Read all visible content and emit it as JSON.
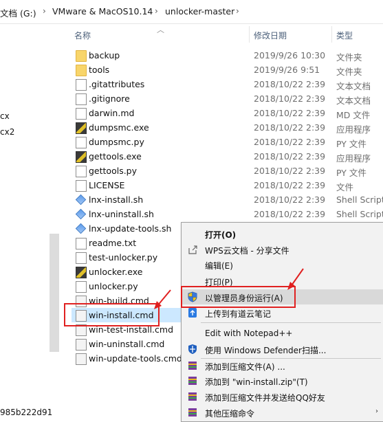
{
  "address": {
    "drive": "文档 (G:)",
    "folder1": "VMware & MacOS10.14",
    "folder2": "unlocker-master"
  },
  "nav": {
    "item_cx": "cx",
    "item_cx2": "cx2",
    "hash": "985b222d91"
  },
  "headers": {
    "name": "名称",
    "date": "修改日期",
    "type": "类型"
  },
  "files": [
    {
      "name": "backup",
      "date": "2019/9/26 10:30",
      "type": "文件夹",
      "icon": "folder"
    },
    {
      "name": "tools",
      "date": "2019/9/26 9:51",
      "type": "文件夹",
      "icon": "folder"
    },
    {
      "name": ".gitattributes",
      "date": "2018/10/22 2:39",
      "type": "文本文档",
      "icon": "file"
    },
    {
      "name": ".gitignore",
      "date": "2018/10/22 2:39",
      "type": "文本文档",
      "icon": "file"
    },
    {
      "name": "darwin.md",
      "date": "2018/10/22 2:39",
      "type": "MD 文件",
      "icon": "file"
    },
    {
      "name": "dumpsmc.exe",
      "date": "2018/10/22 2:39",
      "type": "应用程序",
      "icon": "exe"
    },
    {
      "name": "dumpsmc.py",
      "date": "2018/10/22 2:39",
      "type": "PY 文件",
      "icon": "file"
    },
    {
      "name": "gettools.exe",
      "date": "2018/10/22 2:39",
      "type": "应用程序",
      "icon": "exe"
    },
    {
      "name": "gettools.py",
      "date": "2018/10/22 2:39",
      "type": "PY 文件",
      "icon": "file"
    },
    {
      "name": "LICENSE",
      "date": "2018/10/22 2:39",
      "type": "文件",
      "icon": "file"
    },
    {
      "name": "lnx-install.sh",
      "date": "2018/10/22 2:39",
      "type": "Shell Script",
      "icon": "sh"
    },
    {
      "name": "lnx-uninstall.sh",
      "date": "2018/10/22 2:39",
      "type": "Shell Script",
      "icon": "sh"
    },
    {
      "name": "lnx-update-tools.sh",
      "date": "",
      "type": "",
      "icon": "sh"
    },
    {
      "name": "readme.txt",
      "date": "",
      "type": "",
      "icon": "file"
    },
    {
      "name": "test-unlocker.py",
      "date": "",
      "type": "",
      "icon": "file"
    },
    {
      "name": "unlocker.exe",
      "date": "",
      "type": "",
      "icon": "exe"
    },
    {
      "name": "unlocker.py",
      "date": "",
      "type": "",
      "icon": "file"
    },
    {
      "name": "win-build.cmd",
      "date": "",
      "type": "",
      "icon": "cmd"
    },
    {
      "name": "win-install.cmd",
      "date": "",
      "type": "",
      "icon": "cmd"
    },
    {
      "name": "win-test-install.cmd",
      "date": "",
      "type": "",
      "icon": "cmd"
    },
    {
      "name": "win-uninstall.cmd",
      "date": "",
      "type": "",
      "icon": "cmd"
    },
    {
      "name": "win-update-tools.cmd",
      "date": "",
      "type": "",
      "icon": "cmd"
    }
  ],
  "menu": {
    "open": "打开(O)",
    "wps": "WPS云文档 - 分享文件",
    "edit": "编辑(E)",
    "print": "打印(P)",
    "runas": "以管理员身份运行(A)",
    "youdao": "上传到有道云笔记",
    "notepad": "Edit with Notepad++",
    "defender": "使用 Windows Defender扫描...",
    "addarchive": "添加到压缩文件(A) ...",
    "addzip": "添加到 \"win-install.zip\"(T)",
    "addqq": "添加到压缩文件并发送给QQ好友",
    "other": "其他压缩命令"
  },
  "colors": {
    "selected": "#cce8ff",
    "highlight_red": "#e02020",
    "menu_bg": "#f2f2f2"
  }
}
